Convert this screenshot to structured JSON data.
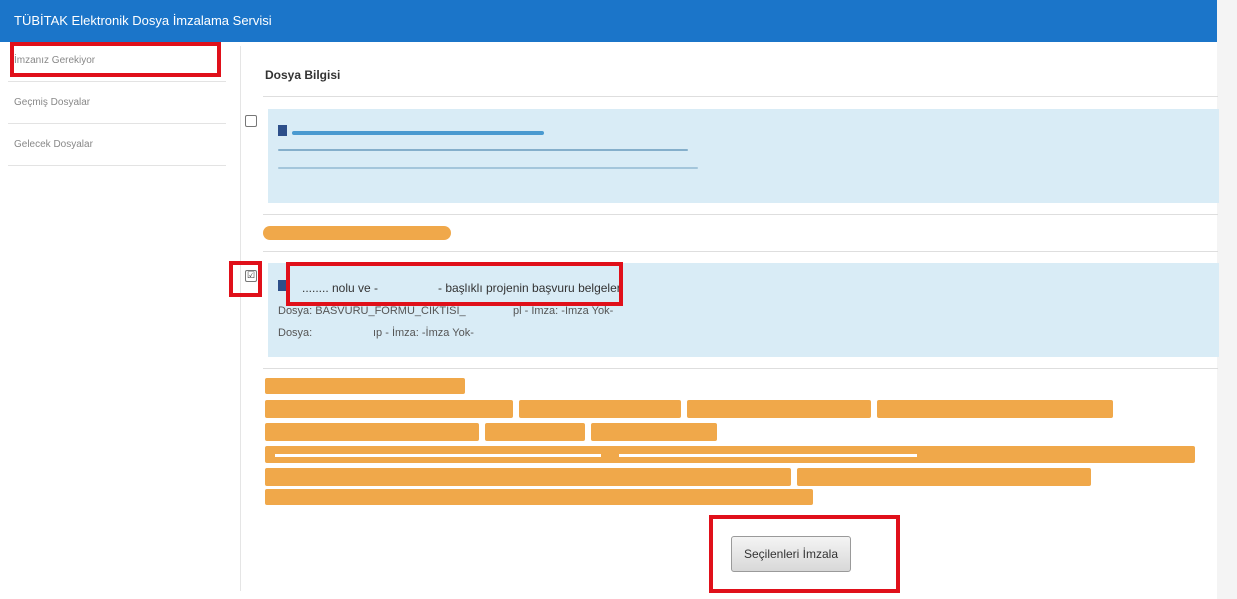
{
  "app": {
    "title": "TÜBİTAK Elektronik Dosya İmzalama Servisi"
  },
  "sidebar": {
    "items": [
      {
        "label": "İmzanız Gerekiyor"
      },
      {
        "label": "Geçmiş Dosyalar"
      },
      {
        "label": "Gelecek Dosyalar"
      }
    ]
  },
  "main": {
    "heading": "Dosya Bilgisi",
    "files": [
      {
        "checked": false,
        "checkbox_glyph": ""
      },
      {
        "checked": true,
        "checkbox_glyph": "☑",
        "title_part1": "........ nolu ve -",
        "title_part2": "- başlıklı projenin başvuru belgeleri",
        "line1": "Dosya: BASVURU_FORMU_CIKTISI_",
        "line1_tail": "pl - İmza: -İmza Yok-",
        "line2_head": "Dosya:",
        "line2_tail": "ıp - İmza: -İmza Yok-"
      }
    ],
    "sign_button_label": "Seçilenleri İmzala"
  },
  "colors": {
    "header_blue": "#1b75c9",
    "highlight_red": "#e0101a",
    "file_box_bg": "#d9ecf6",
    "redaction_orange": "#f0a84a"
  },
  "icons": [
    "file-icon",
    "checkbox-icon"
  ]
}
